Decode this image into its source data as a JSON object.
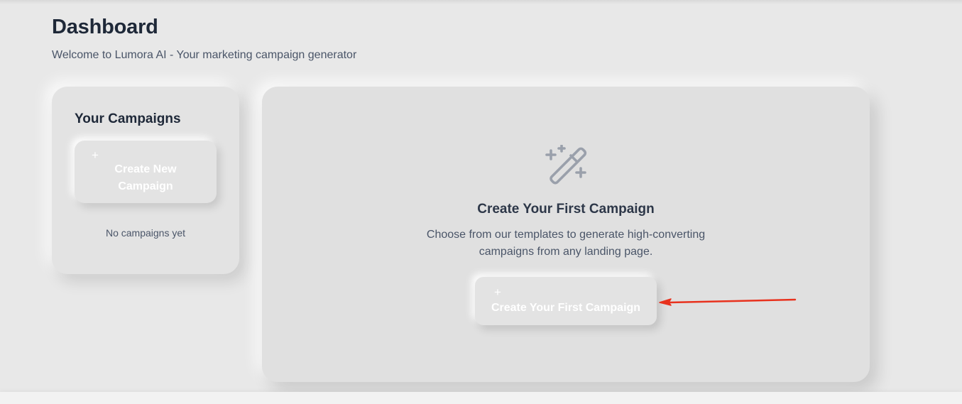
{
  "header": {
    "title": "Dashboard",
    "subtitle": "Welcome to Lumora AI - Your marketing campaign generator"
  },
  "sidebar_card": {
    "title": "Your Campaigns",
    "create_button": {
      "icon": "plus-icon",
      "plus_glyph": "+",
      "label": "Create New Campaign"
    },
    "empty_text": "No campaigns yet"
  },
  "main_card": {
    "icon": "magic-wand-icon",
    "heading": "Create Your First Campaign",
    "description": "Choose from our templates to generate high-converting campaigns from any landing page.",
    "cta_button": {
      "icon": "plus-icon",
      "plus_glyph": "+",
      "label": "Create Your First Campaign"
    }
  },
  "annotation": {
    "type": "arrow",
    "color": "#e8321e",
    "points_to": "Create Your First Campaign button"
  },
  "colors": {
    "background": "#e8e8e8",
    "card": "#e3e3e3",
    "heading_text": "#1e2838",
    "body_text": "#4a5568",
    "icon_gray": "#9aa0ab",
    "button_text": "#ffffff"
  }
}
